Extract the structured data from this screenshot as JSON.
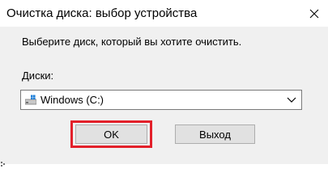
{
  "window": {
    "title": "Очистка диска: выбор устройства"
  },
  "instruction_text": "Выберите диск, который вы хотите очистить.",
  "drives": {
    "label": "Диски:",
    "selected_value": "Windows (C:)",
    "icon": "windows-drive-icon"
  },
  "buttons": {
    "ok_label": "OK",
    "exit_label": "Выход"
  },
  "colors": {
    "highlight": "#e3202a",
    "titlebar_bg": "#ffffff",
    "dialog_bg": "#f0f0f0"
  }
}
